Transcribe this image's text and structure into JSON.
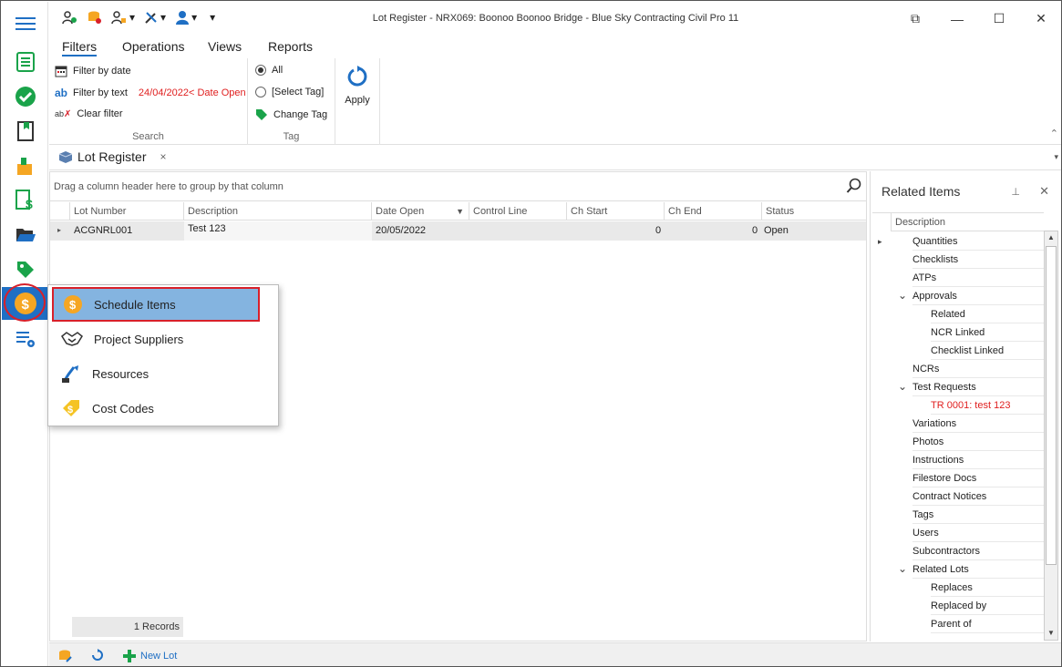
{
  "window": {
    "title": "Lot Register - NRX069: Boonoo Boonoo Bridge  - Blue Sky Contracting Civil Pro 11",
    "min_glyph": "—",
    "max_glyph": "☐",
    "close_glyph": "✕",
    "restore_glyph": "⧉"
  },
  "qat": {
    "more_glyph": "▾"
  },
  "ribbon": {
    "tabs": [
      "Filters",
      "Operations",
      "Views",
      "Reports"
    ],
    "search_group": {
      "label": "Search",
      "filter_by_date": "Filter by date",
      "filter_by_text": "Filter by text",
      "text_icon": "ab",
      "date_filter_value": "24/04/2022< Date Open",
      "clear_filter": "Clear filter",
      "clear_icon": "ab"
    },
    "tag_group": {
      "label": "Tag",
      "all": "All",
      "select_tag": "[Select Tag]",
      "change_tag": "Change Tag"
    },
    "apply": "Apply"
  },
  "doc_tab": {
    "label": "Lot Register",
    "close": "×"
  },
  "grid": {
    "group_hint": "Drag a column header here to group by that column",
    "columns": [
      "Lot Number",
      "Description",
      "Date Open",
      "Control Line",
      "Ch Start",
      "Ch End",
      "Status"
    ],
    "rows": [
      {
        "lot_number": "ACGNRL001",
        "description": "Test 123",
        "date_open": "20/05/2022",
        "control_line": "",
        "ch_start": "",
        "ch_end_a": "0",
        "ch_end_b": "0",
        "status": "Open"
      }
    ],
    "records_label": "1 Records"
  },
  "related": {
    "title": "Related Items",
    "pin": "⊥",
    "close": "✕",
    "column": "Description",
    "items": [
      {
        "label": "Quantities",
        "level": 0,
        "expander": "▸"
      },
      {
        "label": "Checklists",
        "level": 0,
        "expander": ""
      },
      {
        "label": "ATPs",
        "level": 0,
        "expander": ""
      },
      {
        "label": "Approvals",
        "level": 0,
        "expander": "⌄"
      },
      {
        "label": "Related",
        "level": 1,
        "expander": ""
      },
      {
        "label": "NCR Linked",
        "level": 1,
        "expander": ""
      },
      {
        "label": "Checklist Linked",
        "level": 1,
        "expander": ""
      },
      {
        "label": "NCRs",
        "level": 0,
        "expander": ""
      },
      {
        "label": "Test Requests",
        "level": 0,
        "expander": "⌄"
      },
      {
        "label": "TR 0001: test 123",
        "level": 1,
        "expander": "",
        "red": true
      },
      {
        "label": "Variations",
        "level": 0,
        "expander": ""
      },
      {
        "label": "Photos",
        "level": 0,
        "expander": ""
      },
      {
        "label": "Instructions",
        "level": 0,
        "expander": ""
      },
      {
        "label": "Filestore Docs",
        "level": 0,
        "expander": ""
      },
      {
        "label": "Contract Notices",
        "level": 0,
        "expander": ""
      },
      {
        "label": "Tags",
        "level": 0,
        "expander": ""
      },
      {
        "label": "Users",
        "level": 0,
        "expander": ""
      },
      {
        "label": "Subcontractors",
        "level": 0,
        "expander": ""
      },
      {
        "label": "Related Lots",
        "level": 0,
        "expander": "⌄"
      },
      {
        "label": "Replaces",
        "level": 1,
        "expander": ""
      },
      {
        "label": "Replaced by",
        "level": 1,
        "expander": ""
      },
      {
        "label": "Parent of",
        "level": 1,
        "expander": ""
      }
    ]
  },
  "popup": {
    "items": [
      {
        "label": "Schedule Items",
        "icon": "dollar-coin-icon"
      },
      {
        "label": "Project Suppliers",
        "icon": "handshake-icon"
      },
      {
        "label": "Resources",
        "icon": "excavator-icon"
      },
      {
        "label": "Cost Codes",
        "icon": "dollar-tag-icon"
      }
    ]
  },
  "bottom": {
    "new_lot": "New Lot"
  },
  "colors": {
    "accent": "#1f6fc4",
    "green": "#1aa34a",
    "orange": "#f5a623",
    "red": "#d8202a"
  }
}
